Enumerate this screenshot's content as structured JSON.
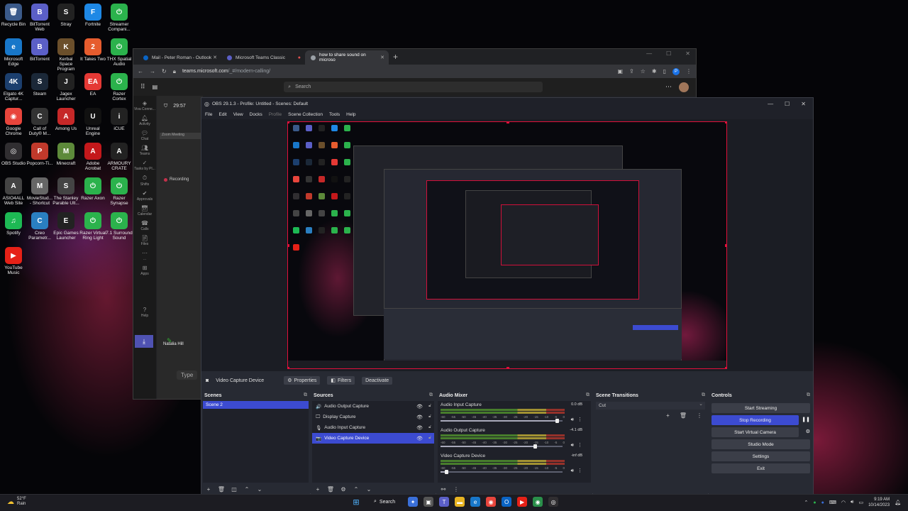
{
  "desktop": {
    "icons": [
      {
        "label": "Recycle Bin",
        "glyph": "🗑",
        "color": "#3b5a8a"
      },
      {
        "label": "BitTorrent Web",
        "glyph": "B",
        "color": "#5b5fc7"
      },
      {
        "label": "Stray",
        "glyph": "S",
        "color": "#222"
      },
      {
        "label": "Fortnite",
        "glyph": "F",
        "color": "#1e88e5"
      },
      {
        "label": "Streamer Compani...",
        "glyph": "⏻",
        "color": "#2bb24c"
      },
      {
        "label": "Microsoft Edge",
        "glyph": "e",
        "color": "#1877c9"
      },
      {
        "label": "BitTorrent",
        "glyph": "B",
        "color": "#5b5fc7"
      },
      {
        "label": "Kerbal Space Program",
        "glyph": "K",
        "color": "#6b4f2b"
      },
      {
        "label": "It Takes Two",
        "glyph": "2",
        "color": "#e65c2e"
      },
      {
        "label": "THX Spatial Audio",
        "glyph": "⏻",
        "color": "#2bb24c"
      },
      {
        "label": "Elgato 4K Captur...",
        "glyph": "4K",
        "color": "#1c3f6e"
      },
      {
        "label": "Steam",
        "glyph": "S",
        "color": "#1b2838"
      },
      {
        "label": "Jagex Launcher",
        "glyph": "J",
        "color": "#222"
      },
      {
        "label": "EA",
        "glyph": "EA",
        "color": "#e53935"
      },
      {
        "label": "Razer Cortex",
        "glyph": "⏻",
        "color": "#2bb24c"
      },
      {
        "label": "Google Chrome",
        "glyph": "◉",
        "color": "#e8453c"
      },
      {
        "label": "Call of Duty® M...",
        "glyph": "C",
        "color": "#333"
      },
      {
        "label": "Among Us",
        "glyph": "A",
        "color": "#c62828"
      },
      {
        "label": "Unreal Engine",
        "glyph": "U",
        "color": "#111"
      },
      {
        "label": "iCUE",
        "glyph": "i",
        "color": "#222"
      },
      {
        "label": "OBS Studio",
        "glyph": "◎",
        "color": "#302e31"
      },
      {
        "label": "Popcorn-Ti...",
        "glyph": "P",
        "color": "#c0392b"
      },
      {
        "label": "Minecraft",
        "glyph": "M",
        "color": "#5d8a3a"
      },
      {
        "label": "Adobe Acrobat",
        "glyph": "A",
        "color": "#c4181b"
      },
      {
        "label": "ARMOURY CRATE",
        "glyph": "A",
        "color": "#222"
      },
      {
        "label": "ASIO4ALL Web Site",
        "glyph": "A",
        "color": "#444"
      },
      {
        "label": "MovieStud... - Shortcut",
        "glyph": "M",
        "color": "#666"
      },
      {
        "label": "The Stanley Parable Ult...",
        "glyph": "S",
        "color": "#444"
      },
      {
        "label": "Razer Axon",
        "glyph": "⏻",
        "color": "#2bb24c"
      },
      {
        "label": "Razer Synapse",
        "glyph": "⏻",
        "color": "#2bb24c"
      },
      {
        "label": "Spotify",
        "glyph": "♫",
        "color": "#1db954"
      },
      {
        "label": "Creo Parametr...",
        "glyph": "C",
        "color": "#2a7fc1"
      },
      {
        "label": "Epic Games Launcher",
        "glyph": "E",
        "color": "#222"
      },
      {
        "label": "Razer Virtual Ring Light",
        "glyph": "⏻",
        "color": "#2bb24c"
      },
      {
        "label": "7.1 Surround Sound",
        "glyph": "⏻",
        "color": "#2bb24c"
      },
      {
        "label": "YouTube Music",
        "glyph": "▶",
        "color": "#e62117"
      }
    ]
  },
  "chrome": {
    "tabs": [
      {
        "title": "Mail - Peter Roman - Outlook",
        "color": "#0a64c4"
      },
      {
        "title": "Microsoft Teams Classic",
        "color": "#5b5fc7"
      },
      {
        "title": "how to share sound on microso",
        "color": "#9aa0a6"
      }
    ],
    "url_host": "teams.microsoft.com",
    "url_path": "/_#/modern-calling/",
    "profile_initial": "P"
  },
  "teams": {
    "search_placeholder": "Search",
    "rail": [
      "Viva Conne...",
      "Activity",
      "Chat",
      "Teams",
      "Tasks by Pl...",
      "Shifts",
      "Approvals",
      "Calendar",
      "Calls",
      "Files",
      "...",
      "Apps",
      "Help"
    ],
    "call_timer": "29:57",
    "meeting_label": "Zoom Meeting",
    "recording_label": "Recording",
    "type_placeholder": "Type",
    "user_name": "Natalia Hill"
  },
  "obs": {
    "title": "OBS 29.1.3 - Profile: Untitled - Scenes: Default",
    "menu": [
      "File",
      "Edit",
      "View",
      "Docks",
      "Profile",
      "Scene Collection",
      "Tools",
      "Help"
    ],
    "source_bar": {
      "selected_source": "Video Capture Device",
      "properties": "Properties",
      "filters": "Filters",
      "deactivate": "Deactivate"
    },
    "scenes": {
      "header": "Scenes",
      "items": [
        "Scene 2"
      ]
    },
    "sources": {
      "header": "Sources",
      "items": [
        {
          "name": "Audio Output Capture",
          "icon": "🔊"
        },
        {
          "name": "Display Capture",
          "icon": "🖵"
        },
        {
          "name": "Audio Input Capture",
          "icon": "🎙"
        },
        {
          "name": "Video Capture Device",
          "icon": "📷"
        }
      ]
    },
    "mixer": {
      "header": "Audio Mixer",
      "ticks": [
        "-60",
        "-55",
        "-50",
        "-45",
        "-40",
        "-35",
        "-30",
        "-25",
        "-20",
        "-15",
        "-10",
        "-5",
        "0"
      ],
      "channels": [
        {
          "name": "Audio Input Capture",
          "db": "0.0 dB",
          "volume": 0.96
        },
        {
          "name": "Audio Output Capture",
          "db": "-4.1 dB",
          "volume": 0.78
        },
        {
          "name": "Video Capture Device",
          "db": "-inf dB",
          "volume": 0.05
        }
      ]
    },
    "transitions": {
      "header": "Scene Transitions",
      "selected": "Cut"
    },
    "controls": {
      "header": "Controls",
      "start_streaming": "Start Streaming",
      "stop_recording": "Stop Recording",
      "start_virtual_camera": "Start Virtual Camera",
      "studio_mode": "Studio Mode",
      "settings": "Settings",
      "exit": "Exit"
    }
  },
  "taskbar": {
    "weather_temp": "52°F",
    "weather_desc": "Rain",
    "search_label": "Search",
    "time": "9:19 AM",
    "date": "10/14/2023"
  }
}
